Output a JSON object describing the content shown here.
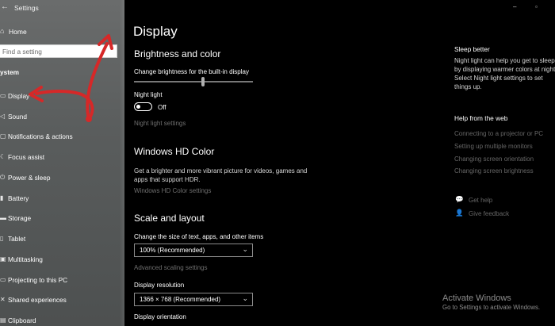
{
  "app": {
    "title": "Settings"
  },
  "sidebar": {
    "home_label": "Home",
    "search_placeholder": "Find a setting",
    "section_label": "ystem",
    "items": [
      {
        "label": "Display",
        "icon": "monitor-icon"
      },
      {
        "label": "Sound",
        "icon": "speaker-icon"
      },
      {
        "label": "Notifications & actions",
        "icon": "notification-icon"
      },
      {
        "label": "Focus assist",
        "icon": "moon-icon"
      },
      {
        "label": "Power & sleep",
        "icon": "power-icon"
      },
      {
        "label": "Battery",
        "icon": "battery-icon"
      },
      {
        "label": "Storage",
        "icon": "storage-icon"
      },
      {
        "label": "Tablet",
        "icon": "tablet-icon"
      },
      {
        "label": "Multitasking",
        "icon": "multitask-icon"
      },
      {
        "label": "Projecting to this PC",
        "icon": "project-icon"
      },
      {
        "label": "Shared experiences",
        "icon": "share-icon"
      },
      {
        "label": "Clipboard",
        "icon": "clipboard-icon"
      }
    ]
  },
  "main": {
    "title": "Display",
    "brightness": {
      "heading": "Brightness and color",
      "slider_label": "Change brightness for the built-in display",
      "level": 0.58
    },
    "night_light": {
      "label": "Night light",
      "state": "Off",
      "settings_link": "Night light settings"
    },
    "hdr": {
      "heading": "Windows HD Color",
      "desc": "Get a brighter and more vibrant picture for videos, games and apps that support HDR.",
      "link": "Windows HD Color settings"
    },
    "scale": {
      "heading": "Scale and layout",
      "size_label": "Change the size of text, apps, and other items",
      "size_value": "100% (Recommended)",
      "advanced_link": "Advanced scaling settings",
      "resolution_label": "Display resolution",
      "resolution_value": "1366 × 768 (Recommended)",
      "orientation_label": "Display orientation"
    }
  },
  "right_panel": {
    "sleep_heading": "Sleep better",
    "sleep_text": "Night light can help you get to sleep by displaying warmer colors at night. Select Night light settings to set things up.",
    "web_heading": "Help from the web",
    "web_links": [
      "Connecting to a projector or PC",
      "Setting up multiple monitors",
      "Changing screen orientation",
      "Changing screen brightness"
    ],
    "get_help": "Get help",
    "give_feedback": "Give feedback"
  },
  "watermark": {
    "title": "Activate Windows",
    "subtitle": "Go to Settings to activate Windows."
  },
  "colors": {
    "arrow": "#d62828",
    "sidebar_bg": "#5e6161",
    "main_bg": "#000000",
    "link_dim": "#6f6f6f"
  }
}
